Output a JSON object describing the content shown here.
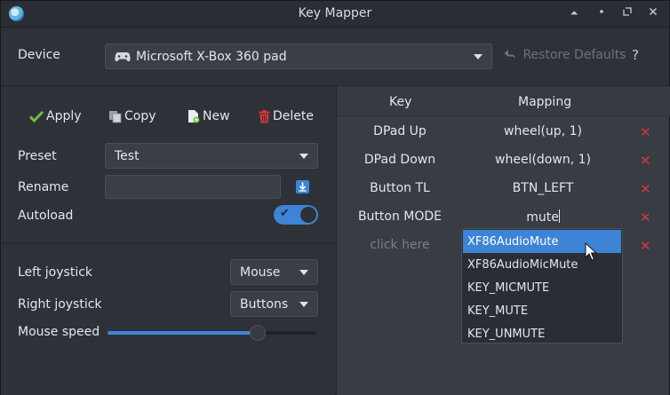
{
  "window": {
    "title": "Key Mapper",
    "controls": [
      "shade-icon",
      "minimize-icon",
      "maximize-icon",
      "close-icon"
    ]
  },
  "device": {
    "label": "Device",
    "selected": "Microsoft X-Box 360 pad",
    "restore_defaults": "Restore Defaults",
    "help": "?"
  },
  "actions": {
    "apply": "Apply",
    "copy": "Copy",
    "new": "New",
    "delete": "Delete"
  },
  "preset": {
    "label": "Preset",
    "selected": "Test",
    "rename_label": "Rename",
    "rename_value": "",
    "autoload_label": "Autoload",
    "autoload_on": true
  },
  "joysticks": {
    "left_label": "Left joystick",
    "left_value": "Mouse",
    "right_label": "Right joystick",
    "right_value": "Buttons",
    "mouse_speed_label": "Mouse speed",
    "mouse_speed_fraction": 0.72
  },
  "table": {
    "headers": {
      "key": "Key",
      "mapping": "Mapping"
    },
    "rows": [
      {
        "key": "DPad Up",
        "mapping": "wheel(up, 1)"
      },
      {
        "key": "DPad Down",
        "mapping": "wheel(down, 1)"
      },
      {
        "key": "Button TL",
        "mapping": "BTN_LEFT"
      },
      {
        "key": "Button MODE",
        "mapping": "mute"
      },
      {
        "key": "click here",
        "mapping": ""
      }
    ],
    "delete_icon": "x-icon"
  },
  "autocomplete": {
    "items": [
      "XF86AudioMute",
      "XF86AudioMicMute",
      "KEY_MICMUTE",
      "KEY_MUTE",
      "KEY_UNMUTE"
    ],
    "selected_index": 0
  },
  "colors": {
    "accent": "#3d84d6",
    "delete": "#e0333b",
    "apply_check": "#6bbf3f",
    "delete_bin": "#e0333b"
  }
}
